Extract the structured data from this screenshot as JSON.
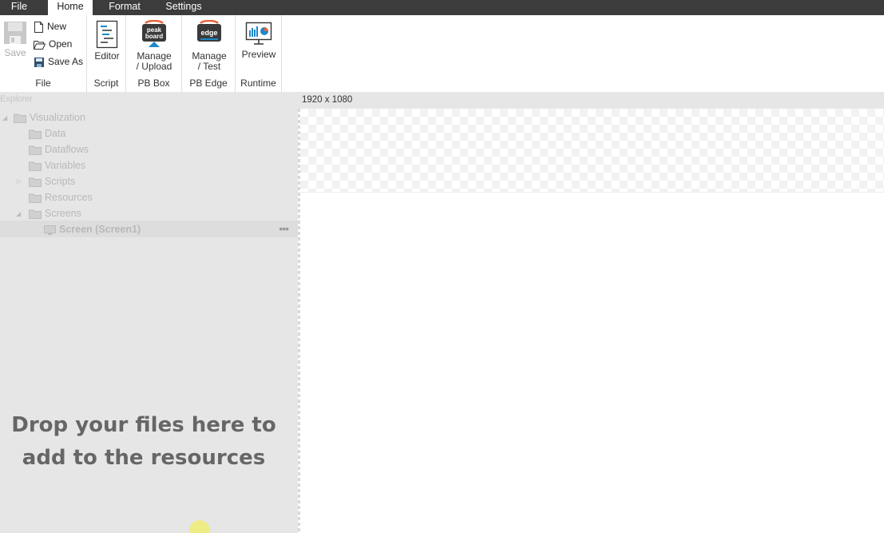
{
  "menu": {
    "tabs": [
      {
        "label": "File"
      },
      {
        "label": "Home"
      },
      {
        "label": "Format"
      },
      {
        "label": "Settings"
      }
    ],
    "active_tab": "Home"
  },
  "ribbon": {
    "file_group": {
      "label": "File",
      "save": "Save",
      "new": "New",
      "open": "Open",
      "save_as": "Save As"
    },
    "script_group": {
      "label": "Script",
      "editor": "Editor"
    },
    "pbbox_group": {
      "label": "PB Box",
      "manage_line1": "Manage",
      "manage_line2": "/ Upload",
      "logo_text_1": "peak",
      "logo_text_2": "board"
    },
    "pbedge_group": {
      "label": "PB Edge",
      "manage_line1": "Manage",
      "manage_line2": "/ Test",
      "logo_text": "edge"
    },
    "runtime_group": {
      "label": "Runtime",
      "preview": "Preview"
    }
  },
  "explorer": {
    "title": "Explorer",
    "tree": {
      "root": "Visualization",
      "data": "Data",
      "dataflows": "Dataflows",
      "variables": "Variables",
      "scripts": "Scripts",
      "resources": "Resources",
      "screens": "Screens",
      "screen1": "Screen (Screen1)"
    },
    "drop_hint_line1": "Drop your files here to",
    "drop_hint_line2": "add to the resources"
  },
  "canvas": {
    "size_label": "1920 x 1080"
  },
  "colors": {
    "menubar": "#3c3c3c",
    "explorer_bg": "#e6e6e6",
    "accent_orange": "#e8623a",
    "preview_blue": "#1e88c8"
  }
}
